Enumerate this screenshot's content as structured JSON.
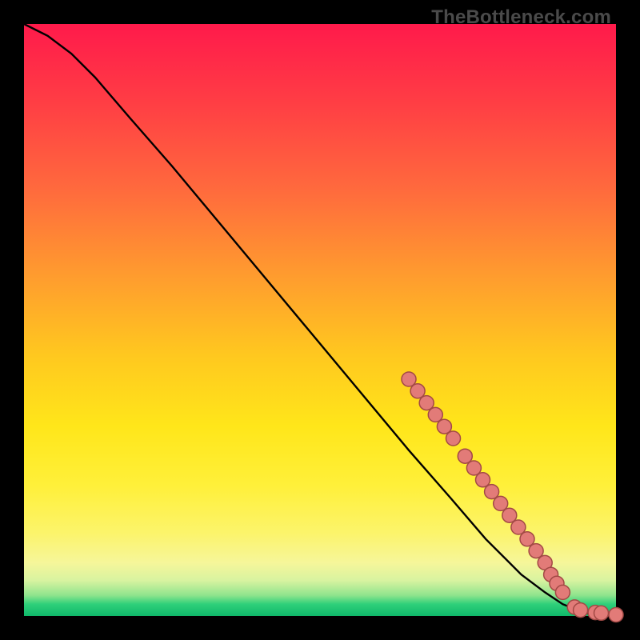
{
  "watermark": "TheBottleneck.com",
  "chart_data": {
    "type": "line",
    "title": "",
    "xlabel": "",
    "ylabel": "",
    "xlim": [
      0,
      100
    ],
    "ylim": [
      0,
      100
    ],
    "series": [
      {
        "name": "curve",
        "x": [
          0,
          4,
          8,
          12,
          18,
          25,
          35,
          45,
          55,
          65,
          72,
          78,
          84,
          88,
          91,
          93.5,
          95,
          97,
          100
        ],
        "y": [
          100,
          98,
          95,
          91,
          84,
          76,
          64,
          52,
          40,
          28,
          20,
          13,
          7,
          4,
          2,
          1,
          0.5,
          0.2,
          0.1
        ]
      }
    ],
    "markers": [
      {
        "x": 65,
        "y": 40
      },
      {
        "x": 66.5,
        "y": 38
      },
      {
        "x": 68,
        "y": 36
      },
      {
        "x": 69.5,
        "y": 34
      },
      {
        "x": 71,
        "y": 32
      },
      {
        "x": 72.5,
        "y": 30
      },
      {
        "x": 74.5,
        "y": 27
      },
      {
        "x": 76,
        "y": 25
      },
      {
        "x": 77.5,
        "y": 23
      },
      {
        "x": 79,
        "y": 21
      },
      {
        "x": 80.5,
        "y": 19
      },
      {
        "x": 82,
        "y": 17
      },
      {
        "x": 83.5,
        "y": 15
      },
      {
        "x": 85,
        "y": 13
      },
      {
        "x": 86.5,
        "y": 11
      },
      {
        "x": 88,
        "y": 9
      },
      {
        "x": 89,
        "y": 7
      },
      {
        "x": 90,
        "y": 5.5
      },
      {
        "x": 91,
        "y": 4
      },
      {
        "x": 93,
        "y": 1.5
      },
      {
        "x": 94,
        "y": 1
      },
      {
        "x": 96.5,
        "y": 0.6
      },
      {
        "x": 97.5,
        "y": 0.5
      },
      {
        "x": 100,
        "y": 0.2
      }
    ],
    "marker_style": {
      "fill": "#e27b78",
      "stroke": "#a24945",
      "r": 9
    }
  }
}
